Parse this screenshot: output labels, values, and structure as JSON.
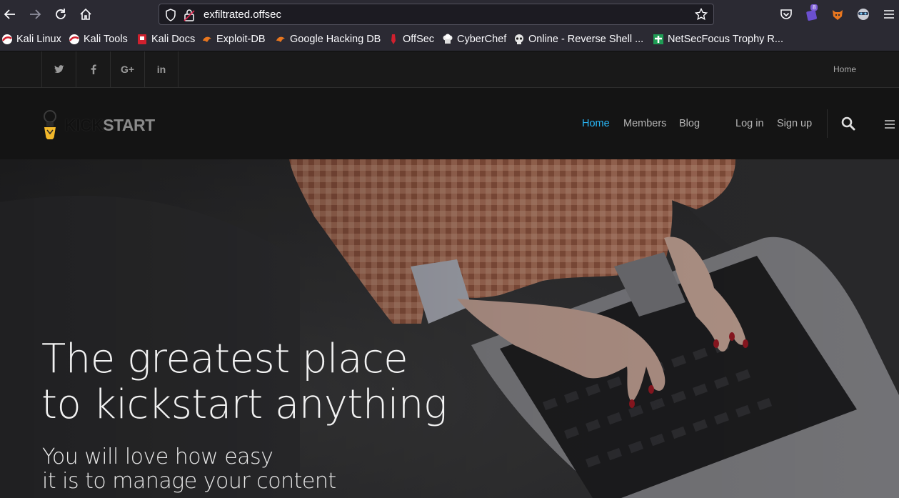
{
  "browser": {
    "url": "exfiltrated.offsec",
    "extension_badge": "8",
    "bookmarks": [
      {
        "label": "Kali Linux",
        "icon": "kali-icon"
      },
      {
        "label": "Kali Tools",
        "icon": "kali-icon"
      },
      {
        "label": "Kali Docs",
        "icon": "kali-docs-icon"
      },
      {
        "label": "Exploit-DB",
        "icon": "exploit-db-icon"
      },
      {
        "label": "Google Hacking DB",
        "icon": "exploit-db-icon"
      },
      {
        "label": "OffSec",
        "icon": "offsec-icon"
      },
      {
        "label": "CyberChef",
        "icon": "cyberchef-icon"
      },
      {
        "label": "Online - Reverse Shell ...",
        "icon": "skull-icon"
      },
      {
        "label": "NetSecFocus Trophy R...",
        "icon": "plus-icon"
      }
    ]
  },
  "site": {
    "social": [
      {
        "label": "twitter",
        "glyph": "t"
      },
      {
        "label": "facebook",
        "glyph": "f"
      },
      {
        "label": "google-plus",
        "glyph": "G+"
      },
      {
        "label": "linkedin",
        "glyph": "in"
      }
    ],
    "top_home": "Home",
    "logo": {
      "kick": "KICK",
      "start": "START"
    },
    "nav": {
      "home": "Home",
      "members": "Members",
      "blog": "Blog",
      "login": "Log in",
      "signup": "Sign up"
    },
    "hero": {
      "title_line1": "The greatest place",
      "title_line2": "to kickstart anything",
      "sub_line1": "You will love how easy",
      "sub_line2": "it is to manage your content"
    }
  },
  "colors": {
    "accent": "#29b6f6",
    "toolbar": "#2b2a33",
    "site_topbar": "#191919",
    "site_navbar": "#141414"
  }
}
